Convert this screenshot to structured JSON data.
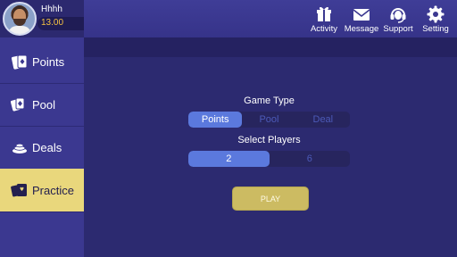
{
  "user": {
    "name": "Hhhh",
    "balance": "13.00"
  },
  "top_actions": [
    {
      "label": "Activity",
      "icon": "gift-icon"
    },
    {
      "label": "Message",
      "icon": "envelope-icon"
    },
    {
      "label": "Support",
      "icon": "headset-icon"
    },
    {
      "label": "Setting",
      "icon": "gear-icon"
    }
  ],
  "sidebar": {
    "items": [
      {
        "label": "Points",
        "icon": "cards-icon",
        "active": false
      },
      {
        "label": "Pool",
        "icon": "pool-cards-icon",
        "active": false
      },
      {
        "label": "Deals",
        "icon": "deals-icon",
        "active": false
      },
      {
        "label": "Practice",
        "icon": "practice-cards-icon",
        "active": true
      }
    ]
  },
  "game_type": {
    "label": "Game Type",
    "options": [
      "Points",
      "Pool",
      "Deal"
    ],
    "selected": "Points"
  },
  "players": {
    "label": "Select Players",
    "options": [
      "2",
      "6"
    ],
    "selected": "2"
  },
  "play_button": {
    "label": "PLAY"
  },
  "colors": {
    "accent_gold": "#e9d77c",
    "selected_blue": "#5b79dd",
    "balance_gold": "#f5c242"
  }
}
